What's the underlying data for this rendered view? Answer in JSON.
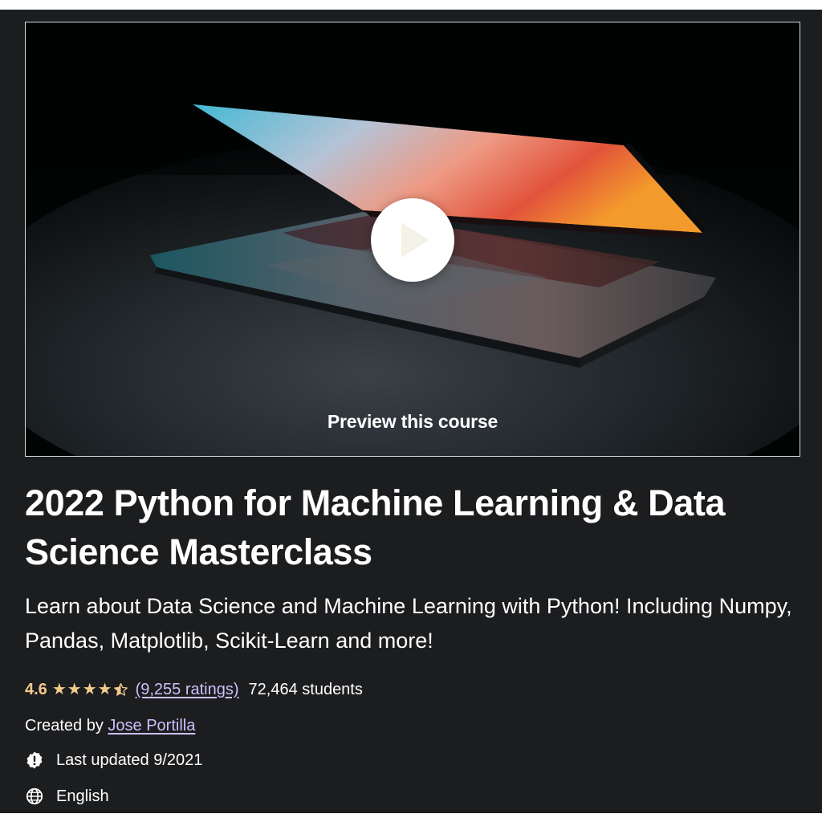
{
  "preview": {
    "label": "Preview this course"
  },
  "course": {
    "title": "2022 Python for Machine Learning & Data Science Masterclass",
    "subtitle": "Learn about Data Science and Machine Learning with Python! Including Numpy, Pandas, Matplotlib, Scikit-Learn and more!",
    "rating": "4.6",
    "rating_value": 4.6,
    "ratings_link": "(9,255 ratings)",
    "students": "72,464 students",
    "created_by_label": "Created by",
    "instructor": "Jose Portilla",
    "last_updated": "Last updated 9/2021",
    "language": "English"
  },
  "colors": {
    "background": "#1c1d1f",
    "rating_gold": "#f3ca8c",
    "link_purple": "#cec0fc",
    "text": "#ffffff"
  },
  "icons": {
    "update": "alert-badge-icon",
    "language": "globe-icon",
    "play": "play-icon"
  }
}
